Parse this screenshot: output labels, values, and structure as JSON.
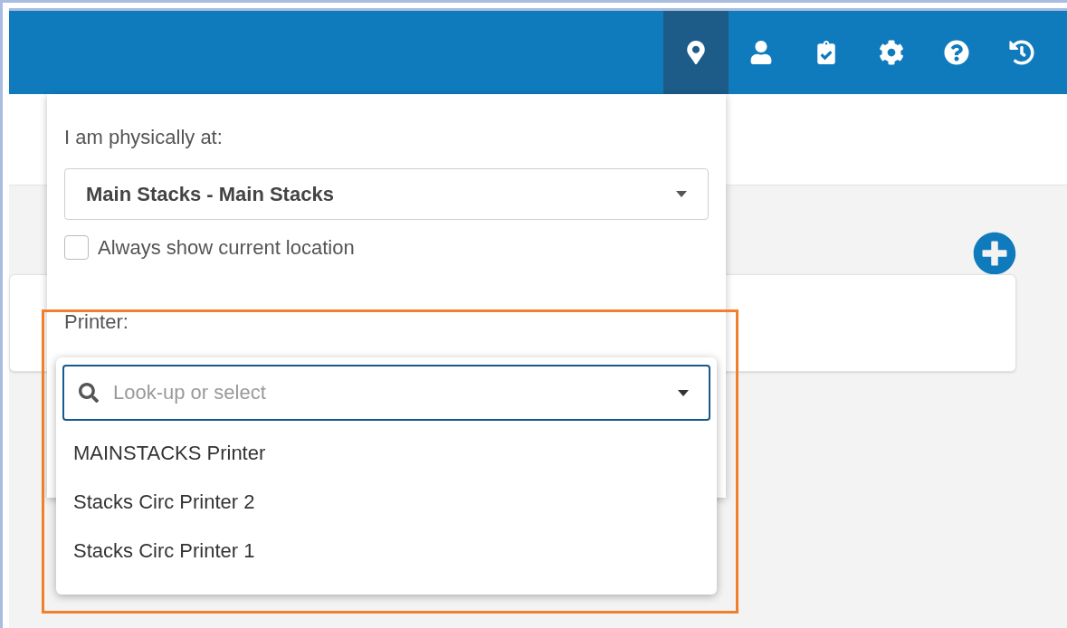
{
  "toolbar": [
    {
      "kind": "location",
      "selected": true
    },
    {
      "kind": "user",
      "selected": false
    },
    {
      "kind": "tasks",
      "selected": false
    },
    {
      "kind": "settings",
      "selected": false
    },
    {
      "kind": "help",
      "selected": false
    },
    {
      "kind": "history",
      "selected": false
    }
  ],
  "location_panel": {
    "label": "I am physically at:",
    "location_value": "Main Stacks - Main Stacks",
    "always_show": {
      "label": "Always show current location",
      "checked": false
    },
    "printer": {
      "label": "Printer:",
      "placeholder": "Look-up or select",
      "options": [
        {
          "label": "MAINSTACKS Printer"
        },
        {
          "label": "Stacks Circ Printer 2"
        },
        {
          "label": "Stacks Circ Printer 1"
        }
      ]
    }
  }
}
